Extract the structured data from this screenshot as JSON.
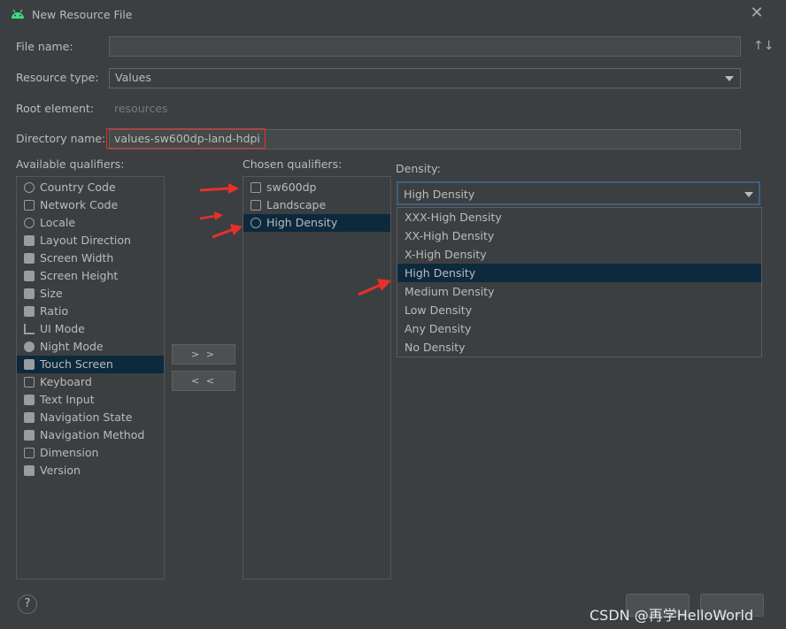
{
  "window": {
    "title": "New Resource File"
  },
  "form": {
    "file_name_label": "File name:",
    "file_name_value": "",
    "resource_type_label": "Resource type:",
    "resource_type_value": "Values",
    "root_element_label": "Root element:",
    "root_element_value": "resources",
    "directory_name_label": "Directory name:",
    "directory_name_value": "values-sw600dp-land-hdpi"
  },
  "available": {
    "label": "Available qualifiers:",
    "items": [
      {
        "label": "Country Code",
        "icon": "globe-icon"
      },
      {
        "label": "Network Code",
        "icon": "network-icon"
      },
      {
        "label": "Locale",
        "icon": "locale-icon"
      },
      {
        "label": "Layout Direction",
        "icon": "layout-direction-icon"
      },
      {
        "label": "Screen Width",
        "icon": "screen-width-icon"
      },
      {
        "label": "Screen Height",
        "icon": "screen-height-icon"
      },
      {
        "label": "Size",
        "icon": "size-icon"
      },
      {
        "label": "Ratio",
        "icon": "ratio-icon"
      },
      {
        "label": "UI Mode",
        "icon": "ui-mode-icon"
      },
      {
        "label": "Night Mode",
        "icon": "night-mode-icon"
      },
      {
        "label": "Touch Screen",
        "icon": "touch-screen-icon"
      },
      {
        "label": "Keyboard",
        "icon": "keyboard-icon"
      },
      {
        "label": "Text Input",
        "icon": "text-input-icon"
      },
      {
        "label": "Navigation State",
        "icon": "navigation-state-icon"
      },
      {
        "label": "Navigation Method",
        "icon": "navigation-method-icon"
      },
      {
        "label": "Dimension",
        "icon": "dimension-icon"
      },
      {
        "label": "Version",
        "icon": "version-icon"
      }
    ],
    "selected": "Touch Screen"
  },
  "buttons": {
    "add": "> >",
    "remove": "< <"
  },
  "chosen": {
    "label": "Chosen qualifiers:",
    "items": [
      {
        "label": "sw600dp",
        "icon": "smallest-width-icon"
      },
      {
        "label": "Landscape",
        "icon": "orientation-icon"
      },
      {
        "label": "High Density",
        "icon": "density-icon"
      }
    ],
    "selected": "High Density"
  },
  "density": {
    "label": "Density:",
    "value": "High Density",
    "options": [
      "XXX-High Density",
      "XX-High Density",
      "X-High Density",
      "High Density",
      "Medium Density",
      "Low Density",
      "Any Density",
      "No Density"
    ],
    "selected": "High Density"
  },
  "footer": {
    "help": "?",
    "watermark": "CSDN @再学HelloWorld"
  },
  "colors": {
    "accent_selection": "#0d293e",
    "annotation_red": "#e8302a"
  }
}
